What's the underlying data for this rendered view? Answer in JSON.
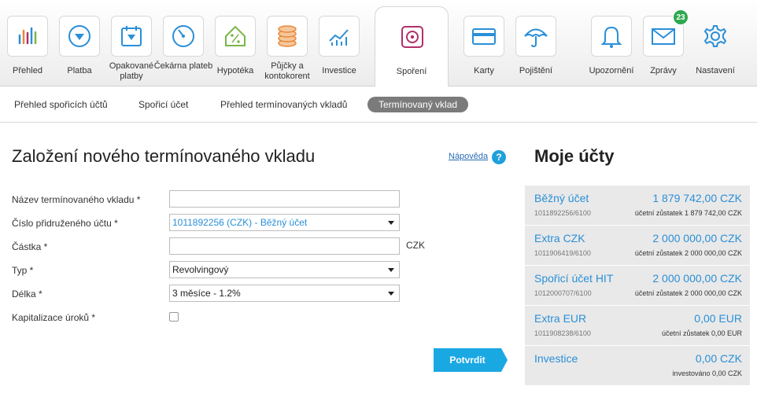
{
  "nav": {
    "items": [
      {
        "label": "Přehled",
        "icon": "bar-chart-icon"
      },
      {
        "label": "Platba",
        "icon": "payment-icon"
      },
      {
        "label": "Opakované platby",
        "icon": "recurring-payment-icon"
      },
      {
        "label": "Čekárna plateb",
        "icon": "gauge-icon"
      },
      {
        "label": "Hypotéka",
        "icon": "house-percent-icon"
      },
      {
        "label": "Půjčky a kontokorent",
        "icon": "coins-icon"
      },
      {
        "label": "Investice",
        "icon": "growth-chart-icon"
      },
      {
        "label": "Spoření",
        "icon": "safe-icon"
      },
      {
        "label": "Karty",
        "icon": "card-icon"
      },
      {
        "label": "Pojištění",
        "icon": "umbrella-icon"
      },
      {
        "label": "Upozornění",
        "icon": "bell-icon"
      },
      {
        "label": "Zprávy",
        "icon": "envelope-icon"
      },
      {
        "label": "Nastavení",
        "icon": "gear-icon"
      }
    ],
    "messages_badge": "23",
    "active": "Spoření"
  },
  "subnav": {
    "items": [
      "Přehled spořicích účtů",
      "Spořicí účet",
      "Přehled termínovaných vkladů",
      "Termínovaný vklad"
    ],
    "active": "Termínovaný vklad"
  },
  "form": {
    "title": "Založení nového termínovaného vkladu",
    "help_label": "Nápověda",
    "help_icon": "?",
    "fields": {
      "name_label": "Název termínovaného vkladu *",
      "name_value": "",
      "account_label": "Číslo přidruženého účtu *",
      "account_value": "1011892256 (CZK) - Běžný účet",
      "amount_label": "Částka *",
      "amount_value": "",
      "currency": "CZK",
      "type_label": "Typ *",
      "type_value": "Revolvingový",
      "length_label": "Délka *",
      "length_value": "3 měsíce - 1.2%",
      "capitalization_label": "Kapitalizace úroků *",
      "capitalization_checked": false
    },
    "confirm_label": "Potvrdit"
  },
  "accounts": {
    "title": "Moje účty",
    "items": [
      {
        "name": "Běžný účet",
        "amount": "1 879 742,00 CZK",
        "number": "1011892256/6100",
        "balance": "účetní zůstatek 1 879 742,00 CZK"
      },
      {
        "name": "Extra CZK",
        "amount": "2 000 000,00 CZK",
        "number": "1011906419/6100",
        "balance": "účetní zůstatek 2 000 000,00 CZK"
      },
      {
        "name": "Spořicí účet HIT",
        "amount": "2 000 000,00 CZK",
        "number": "1012000707/6100",
        "balance": "účetní zůstatek 2 000 000,00 CZK"
      },
      {
        "name": "Extra EUR",
        "amount": "0,00 EUR",
        "number": "1011908238/6100",
        "balance": "účetní zůstatek 0,00 EUR"
      },
      {
        "name": "Investice",
        "amount": "0,00 CZK",
        "number": "",
        "balance": "investováno 0,00 CZK"
      }
    ]
  },
  "colors": {
    "accent_blue": "#1aa8e3",
    "link_blue": "#2a8fd8",
    "badge_green": "#2fa84f",
    "icon_blue": "#2a8fd8",
    "icon_green": "#7ab648",
    "icon_orange": "#e8883a",
    "icon_pink": "#b0306a"
  }
}
